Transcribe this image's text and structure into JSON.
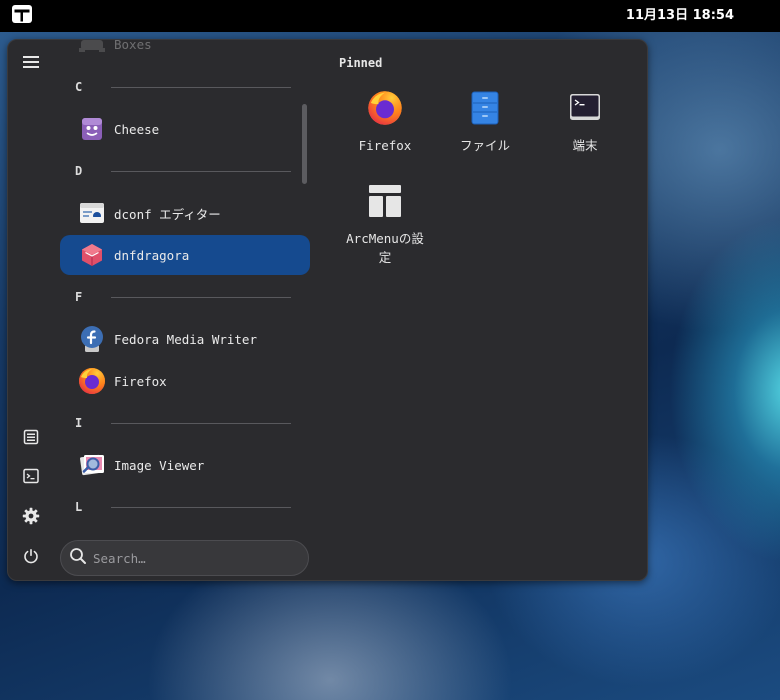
{
  "topbar": {
    "clock": "11月13日  18:54",
    "activities_icon": "arcmenu-icon"
  },
  "sidebar": {
    "buttons": [
      {
        "name": "hamburger-menu-button",
        "icon": "menu-icon"
      },
      {
        "name": "documents-button",
        "icon": "document-icon"
      },
      {
        "name": "terminal-button",
        "icon": "terminal-icon"
      },
      {
        "name": "settings-button",
        "icon": "gear-icon"
      },
      {
        "name": "power-button",
        "icon": "power-icon"
      }
    ]
  },
  "applist": {
    "partial_top_item": "Boxes",
    "groups": [
      {
        "letter": "C",
        "apps": [
          {
            "name": "Cheese",
            "icon": "cheese-icon"
          }
        ]
      },
      {
        "letter": "D",
        "apps": [
          {
            "name": "dconf エディター",
            "icon": "dconf-editor-icon"
          },
          {
            "name": "dnfdragora",
            "icon": "dnfdragora-icon",
            "selected": true
          }
        ]
      },
      {
        "letter": "F",
        "apps": [
          {
            "name": "Fedora Media Writer",
            "icon": "fedora-media-writer-icon"
          },
          {
            "name": "Firefox",
            "icon": "firefox-icon"
          }
        ]
      },
      {
        "letter": "I",
        "apps": [
          {
            "name": "Image Viewer",
            "icon": "image-viewer-icon"
          }
        ]
      },
      {
        "letter": "L",
        "apps": []
      }
    ]
  },
  "search": {
    "placeholder": "Search…",
    "icon": "search-icon"
  },
  "pinned": {
    "title": "Pinned",
    "items": [
      {
        "label": "Firefox",
        "icon": "firefox-icon"
      },
      {
        "label": "ファイル",
        "icon": "files-icon"
      },
      {
        "label": "端末",
        "icon": "terminal-icon"
      },
      {
        "label": "ArcMenuの設定",
        "icon": "arcmenu-settings-icon"
      }
    ]
  },
  "colors": {
    "panel_bg": "#2b2b2e",
    "selected_bg": "#154a8f",
    "topbar_bg": "#000000"
  }
}
